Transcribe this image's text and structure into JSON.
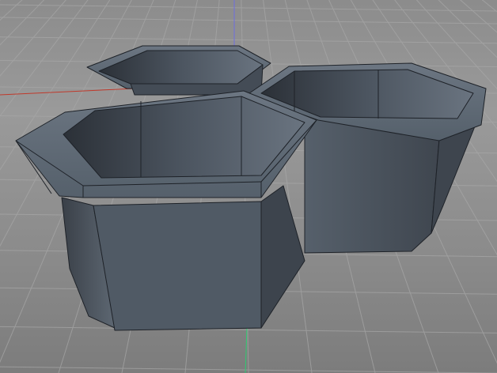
{
  "scene": {
    "description_free": true,
    "background_color": "#929292",
    "grid_color": "#a8a8a8",
    "x_axis_color": "#c0392b",
    "y_axis_color": "#6e6ee0",
    "z_axis_color": "#2ecc71",
    "object_color": "#4f5864",
    "edge_color": "#1e2228"
  }
}
